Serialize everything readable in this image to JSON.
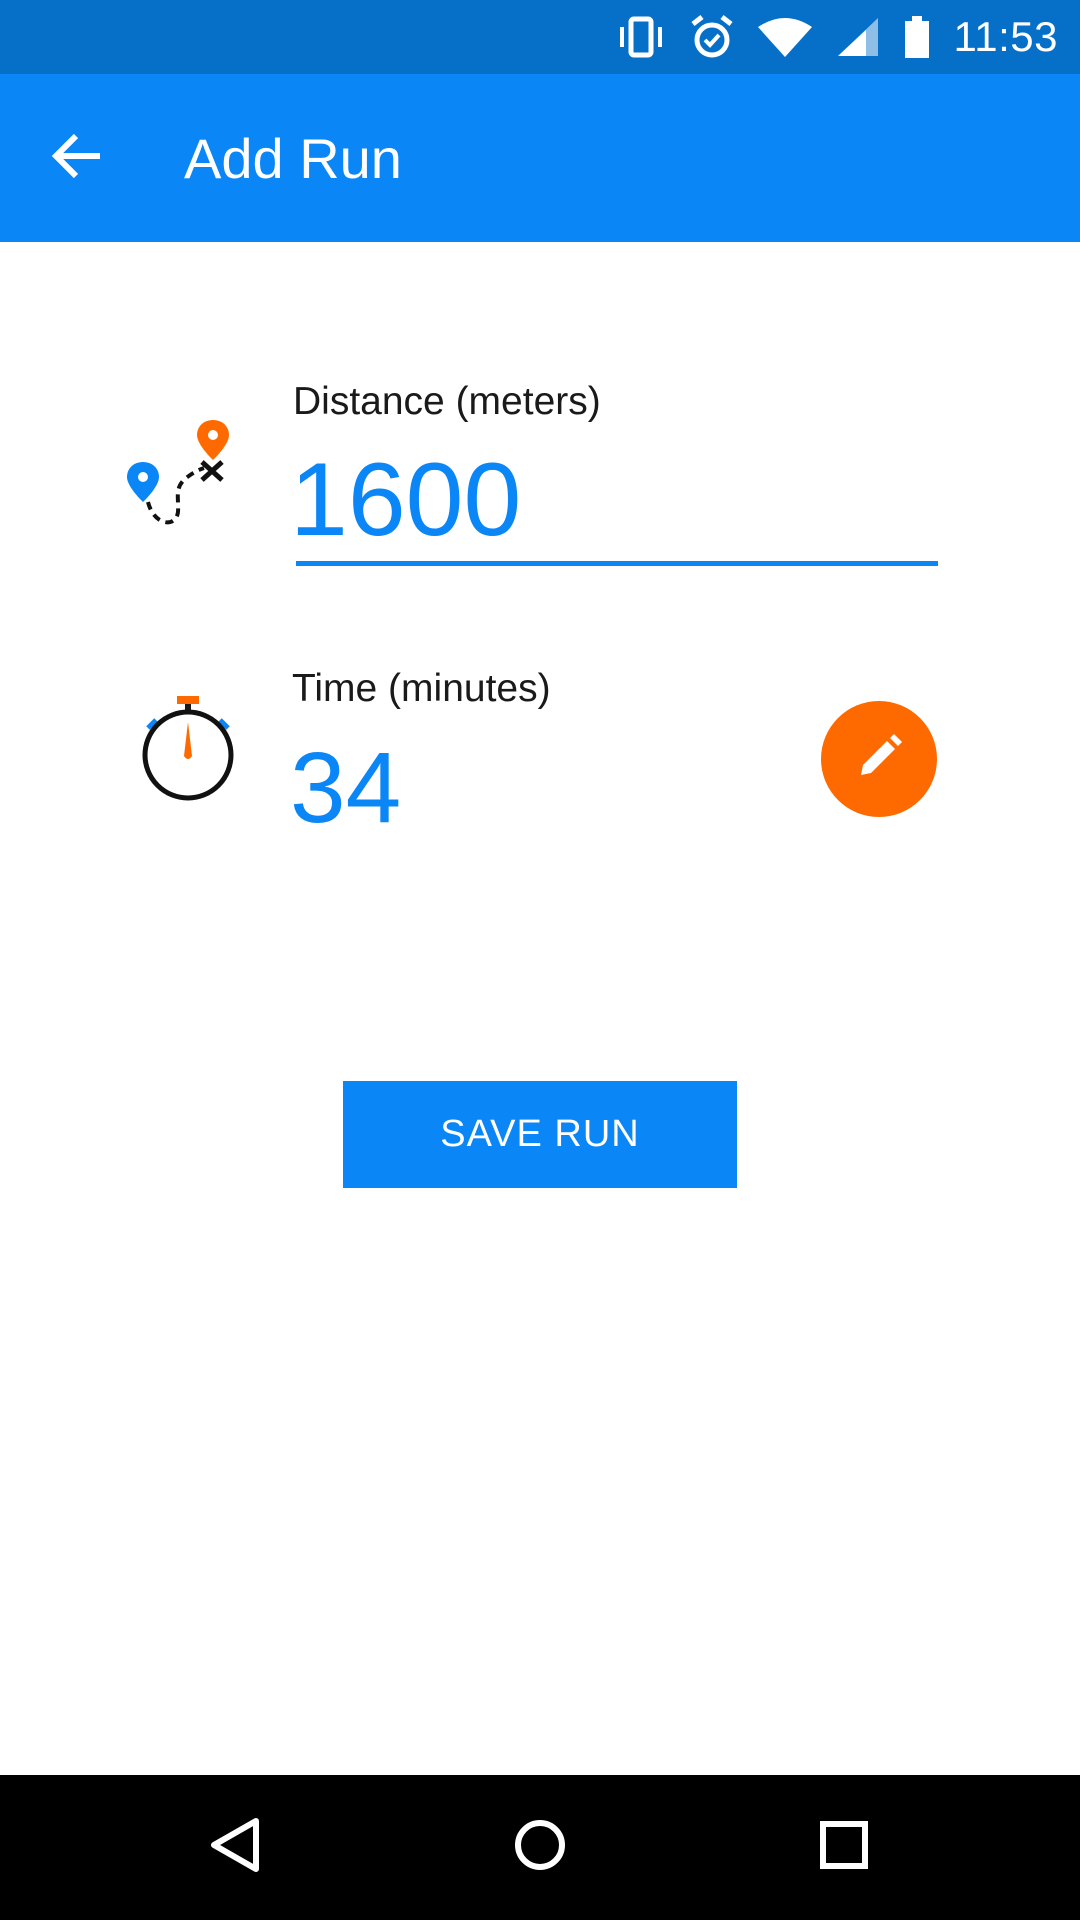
{
  "status_bar": {
    "time": "11:53",
    "icons": [
      "vibrate-icon",
      "alarm-icon",
      "wifi-icon",
      "signal-icon",
      "battery-icon"
    ]
  },
  "app_bar": {
    "title": "Add Run",
    "back_icon": "arrow-back-icon"
  },
  "distance": {
    "label": "Distance (meters)",
    "value": "1600",
    "icon": "route-map-icon"
  },
  "time": {
    "label": "Time (minutes)",
    "value": "34",
    "icon": "stopwatch-icon",
    "edit_icon": "pencil-icon"
  },
  "save_button": {
    "label": "SAVE RUN"
  },
  "nav_bar": {
    "buttons": [
      "back-triangle-icon",
      "home-circle-icon",
      "recents-square-icon"
    ]
  },
  "colors": {
    "primary": "#0a86f7",
    "status_bar": "#0670c8",
    "accent": "#ff6a00",
    "nav_bar": "#000000"
  }
}
